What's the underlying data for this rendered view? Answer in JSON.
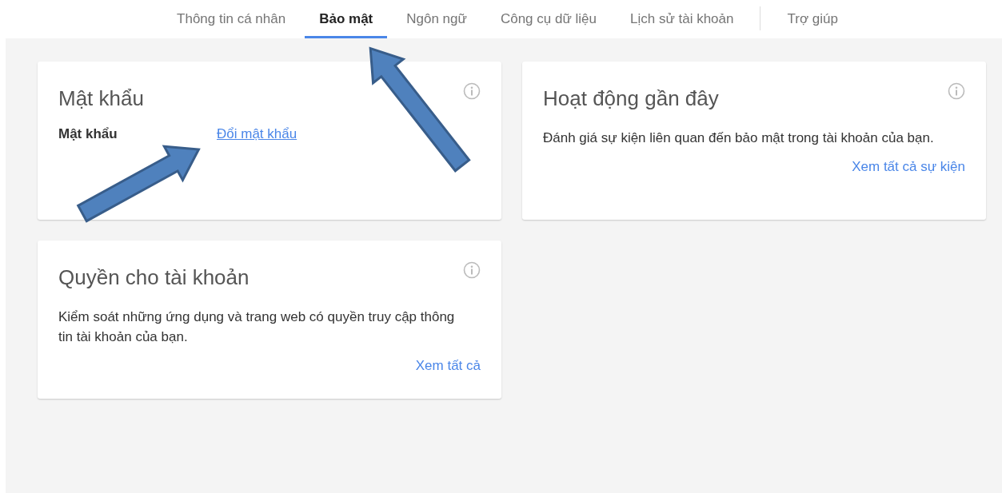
{
  "nav": {
    "tabs": [
      {
        "label": "Thông tin cá nhân",
        "selected": false
      },
      {
        "label": "Bảo mật",
        "selected": true
      },
      {
        "label": "Ngôn ngữ",
        "selected": false
      },
      {
        "label": "Công cụ dữ liệu",
        "selected": false
      },
      {
        "label": "Lịch sử tài khoản",
        "selected": false
      }
    ],
    "help": "Trợ giúp"
  },
  "cards": [
    {
      "kind": "password",
      "title": "Mật khẩu",
      "row_label": "Mật khẩu",
      "link": "Đổi mật khẩu"
    },
    {
      "kind": "text",
      "title": "Hoạt động gần đây",
      "description": "Đánh giá sự kiện liên quan đến bảo mật trong tài khoản của bạn.",
      "action": "Xem tất cả sự kiện"
    },
    {
      "kind": "text",
      "title": "Quyền cho tài khoản",
      "description": "Kiểm soát những ứng dụng và trang web có quyền truy cập thông tin tài khoản của bạn.",
      "action": "Xem tất cả"
    }
  ]
}
